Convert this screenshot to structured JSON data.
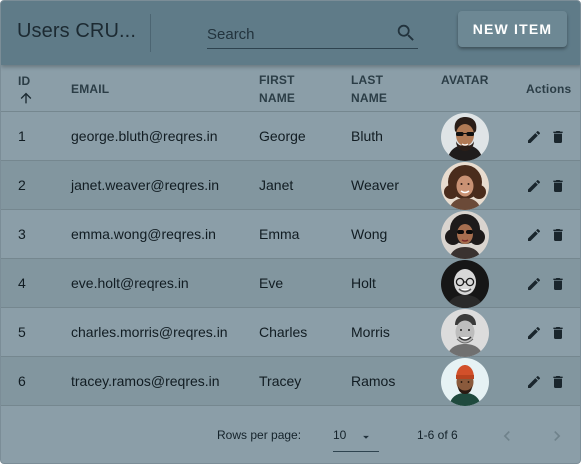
{
  "toolbar": {
    "title": "Users CRU...",
    "search_placeholder": "Search",
    "new_item_label": "NEW ITEM"
  },
  "table": {
    "headers": {
      "id": "ID",
      "email": "EMAIL",
      "first_name": "FIRST NAME",
      "last_name": "LAST NAME",
      "avatar": "AVATAR",
      "actions": "Actions"
    },
    "sort": {
      "column": "id",
      "direction": "ascending"
    },
    "rows": [
      {
        "id": "1",
        "email": "george.bluth@reqres.in",
        "first_name": "George",
        "last_name": "Bluth",
        "avatar_icon": "man-sunglasses-avatar"
      },
      {
        "id": "2",
        "email": "janet.weaver@reqres.in",
        "first_name": "Janet",
        "last_name": "Weaver",
        "avatar_icon": "woman-curly-hair-avatar"
      },
      {
        "id": "3",
        "email": "emma.wong@reqres.in",
        "first_name": "Emma",
        "last_name": "Wong",
        "avatar_icon": "woman-sunglasses-avatar"
      },
      {
        "id": "4",
        "email": "eve.holt@reqres.in",
        "first_name": "Eve",
        "last_name": "Holt",
        "avatar_icon": "bald-man-glasses-avatar"
      },
      {
        "id": "5",
        "email": "charles.morris@reqres.in",
        "first_name": "Charles",
        "last_name": "Morris",
        "avatar_icon": "smiling-man-avatar"
      },
      {
        "id": "6",
        "email": "tracey.ramos@reqres.in",
        "first_name": "Tracey",
        "last_name": "Ramos",
        "avatar_icon": "man-beanie-avatar"
      }
    ],
    "row_action_icons": [
      "pencil-icon",
      "trash-icon"
    ]
  },
  "footer": {
    "rows_per_page_label": "Rows per page:",
    "rows_per_page_value": "10",
    "range_text": "1-6 of 6",
    "prev_enabled": false,
    "next_enabled": false
  },
  "colors": {
    "toolbar": "#5f7b88",
    "table_bg": "#8b9ea8",
    "row_alt": "#82969f",
    "button": "#6d8894",
    "text": "#111c22"
  }
}
